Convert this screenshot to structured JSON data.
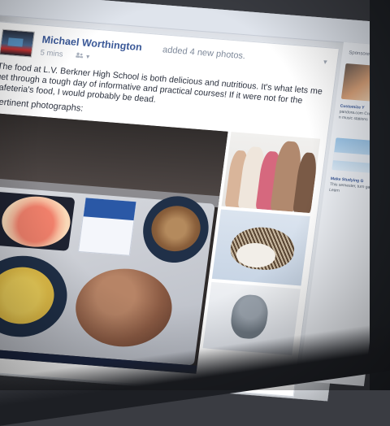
{
  "post": {
    "author": "Michael Worthington",
    "action": "added 4 new photos.",
    "time": "5 mins",
    "text": "The food at L.V. Berkner High School is both delicious and nutritious. It's what lets me get through a tough day of informative and practical courses! If it were not for the cafeteria's food, I would probably be dead.",
    "caption": "Pertinent photographs:"
  },
  "sidebar": {
    "sponsored": "Sponsored",
    "ads": [
      {
        "title": "Customize Y",
        "text": "pandora.com Create your n music stations"
      },
      {
        "title": "Make Studying G",
        "text": "This semester, turn game. Learn"
      }
    ]
  },
  "colors": {
    "link": "#3b5998",
    "text": "#2d3340",
    "meta": "#9aa3b2"
  },
  "icons": [
    "friends-icon",
    "chevron-down-icon"
  ]
}
